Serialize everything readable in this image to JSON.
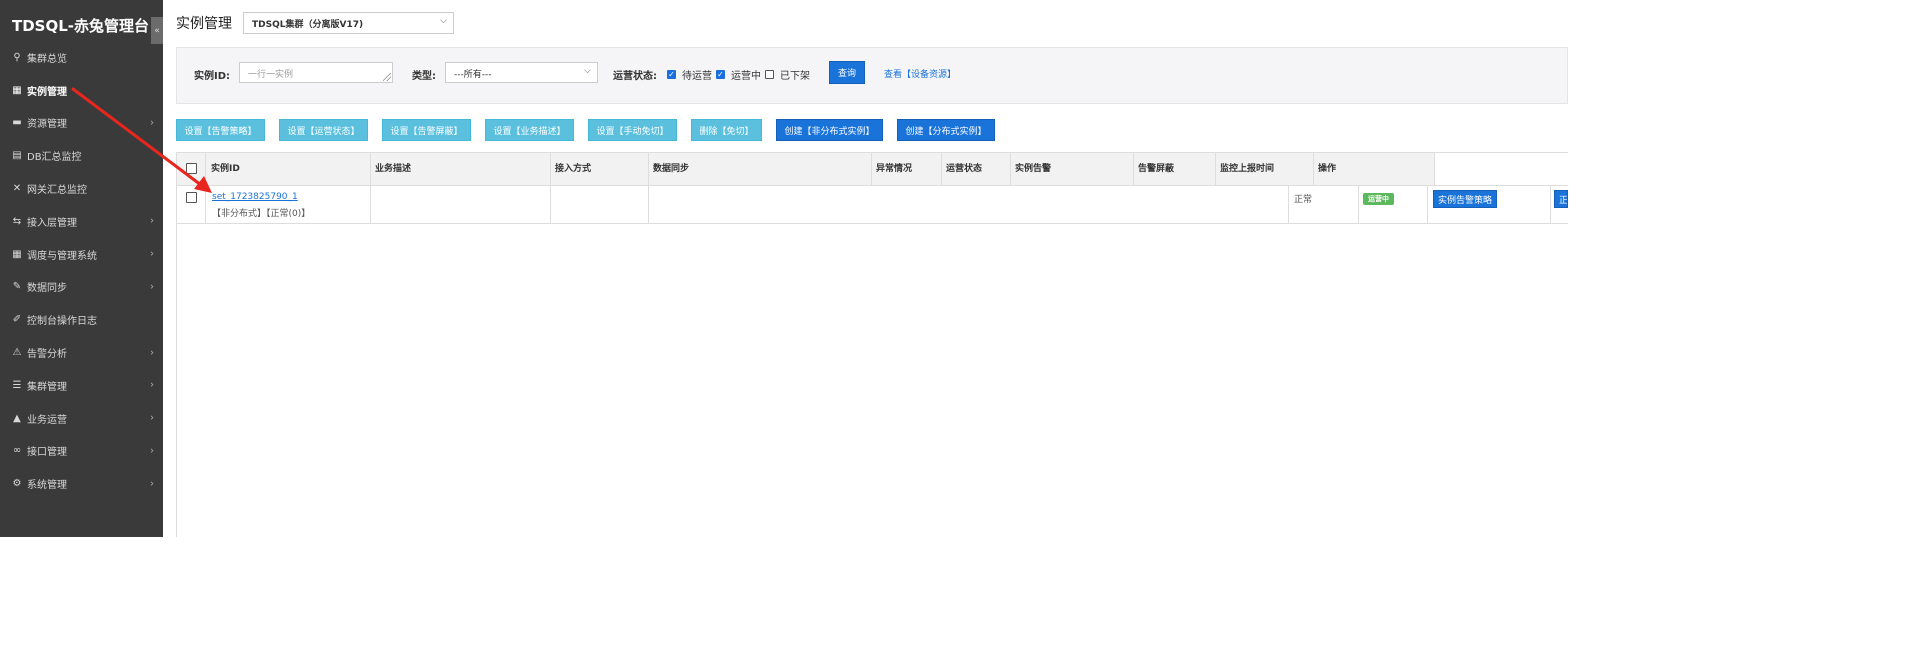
{
  "app": {
    "title": "TDSQL-赤兔管理台",
    "collapse_icon": "«"
  },
  "sidebar": {
    "items": [
      {
        "label": "集群总览",
        "icon": "search-icon",
        "glyph": "⚲",
        "chevron": false,
        "active": false
      },
      {
        "label": "实例管理",
        "icon": "grid-icon",
        "glyph": "▦",
        "chevron": false,
        "active": true
      },
      {
        "label": "资源管理",
        "icon": "disk-icon",
        "glyph": "▬",
        "chevron": true,
        "active": false
      },
      {
        "label": "DB汇总监控",
        "icon": "book-icon",
        "glyph": "▤",
        "chevron": false,
        "active": false
      },
      {
        "label": "网关汇总监控",
        "icon": "shuffle-icon",
        "glyph": "✕",
        "chevron": false,
        "active": false
      },
      {
        "label": "接入层管理",
        "icon": "retweet-icon",
        "glyph": "⇆",
        "chevron": true,
        "active": false
      },
      {
        "label": "调度与管理系统",
        "icon": "grid-icon",
        "glyph": "▦",
        "chevron": true,
        "active": false
      },
      {
        "label": "数据同步",
        "icon": "pin-icon",
        "glyph": "✎",
        "chevron": true,
        "active": false
      },
      {
        "label": "控制台操作日志",
        "icon": "wrench-icon",
        "glyph": "✐",
        "chevron": false,
        "active": false
      },
      {
        "label": "告警分析",
        "icon": "warning-icon",
        "glyph": "⚠",
        "chevron": true,
        "active": false
      },
      {
        "label": "集群管理",
        "icon": "list-icon",
        "glyph": "☰",
        "chevron": true,
        "active": false
      },
      {
        "label": "业务运营",
        "icon": "road-icon",
        "glyph": "▲",
        "chevron": true,
        "active": false
      },
      {
        "label": "接口管理",
        "icon": "link-icon",
        "glyph": "∞",
        "chevron": true,
        "active": false
      },
      {
        "label": "系统管理",
        "icon": "gear-icon",
        "glyph": "⚙",
        "chevron": true,
        "active": false
      }
    ]
  },
  "header": {
    "title": "实例管理",
    "cluster_selected": "TDSQL集群（分离版V17)"
  },
  "filters": {
    "instance_id_label": "实例ID:",
    "instance_id_placeholder": "一行一实例",
    "type_label": "类型:",
    "type_selected": "---所有---",
    "status_label": "运营状态:",
    "status_options": [
      {
        "label": "待运营",
        "checked": true
      },
      {
        "label": "运营中",
        "checked": true
      },
      {
        "label": "已下架",
        "checked": false
      }
    ],
    "query_button": "查询",
    "view_resource_link": "查看【设备资源】"
  },
  "toolbar": {
    "buttons": [
      {
        "label": "设置【告警策略】",
        "style": "cyan"
      },
      {
        "label": "设置【运营状态】",
        "style": "cyan"
      },
      {
        "label": "设置【告警屏蔽】",
        "style": "cyan"
      },
      {
        "label": "设置【业务描述】",
        "style": "cyan"
      },
      {
        "label": "设置【手动免切】",
        "style": "cyan"
      },
      {
        "label": "删除【免切】",
        "style": "cyan"
      },
      {
        "label": "创建【非分布式实例】",
        "style": "blue"
      },
      {
        "label": "创建【分布式实例】",
        "style": "blue"
      }
    ]
  },
  "table": {
    "columns": [
      "实例ID",
      "业务描述",
      "接入方式",
      "数据同步",
      "异常情况",
      "运营状态",
      "实例告警",
      "告警屏蔽",
      "监控上报时间",
      "操作"
    ],
    "rows": [
      {
        "instance_id": "set_1723825790_1",
        "instance_sub": "【非分布式】【正常(0)】",
        "anomaly": "正常",
        "status_badge": "运营中",
        "actions": [
          "实例告警策略",
          "正"
        ]
      }
    ]
  },
  "colors": {
    "sidebar_bg": "#3a3a3a",
    "primary": "#1a73d9",
    "info": "#5bc0de",
    "success": "#5cb85c",
    "annotation_arrow": "#e8261f"
  }
}
